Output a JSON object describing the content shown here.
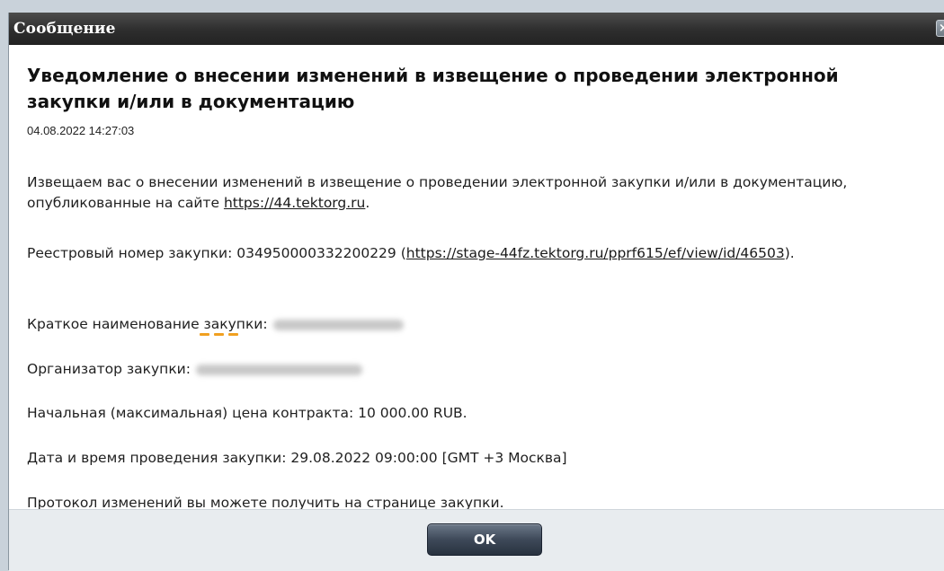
{
  "window": {
    "title": "Сообщение",
    "close_icon": "close-icon"
  },
  "message": {
    "heading": "Уведомление о внесении изменений в извещение о проведении электронной закупки и/или в документацию",
    "datetime": "04.08.2022 14:27:03",
    "intro_text": "Извещаем вас о внесении изменений в извещение о проведении электронной закупки и/или в документацию, опубликованные на сайте ",
    "intro_link": "https://44.tektorg.ru",
    "intro_end": ".",
    "registry_label": "Реестровый номер закупки: 034950000332200229 (",
    "registry_link": "https://stage-44fz.tektorg.ru/pprf615/ef/view/id/46503",
    "registry_end": ").",
    "short_name_label": "Краткое наименование закупки:",
    "organizer_label": "Организатор закупки:",
    "price_text": "Начальная (максимальная) цена контракта: 10 000.00 RUB.",
    "date_text": "Дата и время проведения закупки: 29.08.2022 09:00:00 [GMT +3 Москва]",
    "protocol_text": "Протокол изменений вы можете получить на странице закупки."
  },
  "footer": {
    "ok_label": "OK"
  },
  "colors": {
    "titlebar": "#2e2e2e",
    "highlight_dash": "#f0a020",
    "button": "#3e4959"
  }
}
